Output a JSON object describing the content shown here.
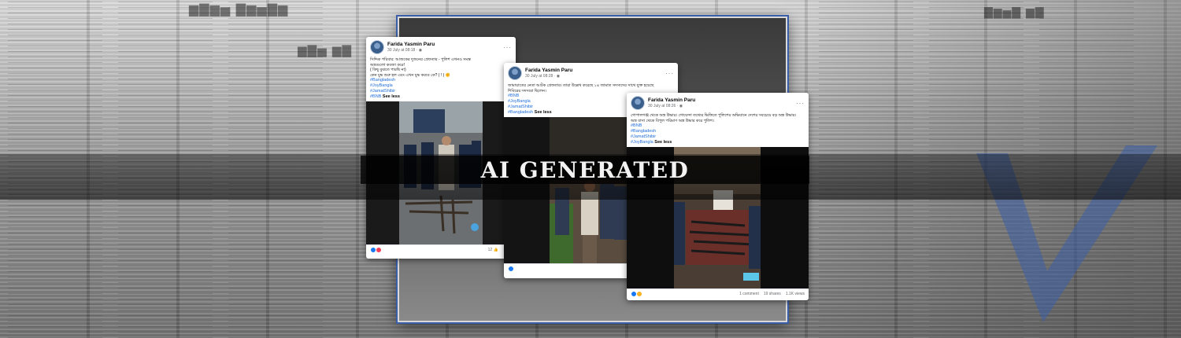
{
  "overlay": {
    "label": "AI GENERATED"
  },
  "posts": [
    {
      "author": "Farida Yasmin Paru",
      "date": "30 July at 08:18",
      "text_lines": [
        "সিদ্দিক পরিবার: আজকের দুজনের গ্রেফতার - পুলিশ এখনও সমস্ত",
        "অস্ত্রগুলো কবজা করে!",
        "( কিছু বুঝতে পারছি না)",
        "কেন যুদ্ধ শুরু হল এবং এখন যুদ্ধ করবে কে? ( ! ) ✊"
      ],
      "hashtags": [
        "#Bangladesh",
        "#JoyBangla",
        "#JamatShibir",
        "#BNB"
      ],
      "see_less": "See less",
      "reactions": "12",
      "shares": "47"
    },
    {
      "author": "Farida Yasmin Paru",
      "date": "30 July at 08:28",
      "text_lines": [
        "জামায়াতের নেতা আটক গ্রেফতার। তারা উল্লেখ করেছে ১৪ জামাত সদস্যদের সাথে যুক্ত হয়েছে",
        "শিবিরের সদস্যরা ছিলেন।"
      ],
      "hashtags": [
        "#BNB",
        "#JoyBangla",
        "#JamatShibir",
        "#Bangladesh"
      ],
      "see_less": "See less"
    },
    {
      "author": "Farida Yasmin Paru",
      "date": "30 July at 08:26",
      "text_lines": [
        "গোপালগঞ্জ থেকে অস্ত্র উদ্ধার। গোয়েন্দা তথ্যের ভিত্তিতে পুলিশের অভিযানে দেশের সবচেয়ে বড় অস্ত্র উদ্ধার।",
        "অস্ত্র বাসা থেকে বিপুল পরিমাণ অস্ত্র উদ্ধার করে পুলিশ।"
      ],
      "hashtags": [
        "#BNB",
        "#Bangladesh",
        "#JamatShibir",
        "#JoyBangla"
      ],
      "see_less": "See less",
      "comments": "1 comment",
      "shares": "19 shares",
      "views": "1.1K views"
    }
  ],
  "colors": {
    "link": "#216fdb",
    "frame_border": "#3a5ea8"
  }
}
